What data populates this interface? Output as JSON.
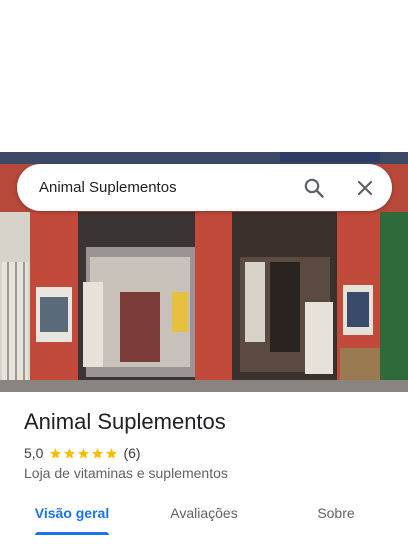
{
  "search": {
    "value": "Animal Suplementos"
  },
  "place": {
    "title": "Animal Suplementos",
    "rating": "5,0",
    "stars": 5,
    "review_count": "(6)",
    "category": "Loja de vitaminas e suplementos"
  },
  "tabs": [
    {
      "label": "Visão geral",
      "active": true
    },
    {
      "label": "Avaliações",
      "active": false
    },
    {
      "label": "Sobre",
      "active": false
    }
  ],
  "colors": {
    "accent": "#1a73e8",
    "star": "#fbbc04"
  },
  "icons": {
    "search": "search-icon",
    "close": "close-icon",
    "star": "star-icon"
  }
}
